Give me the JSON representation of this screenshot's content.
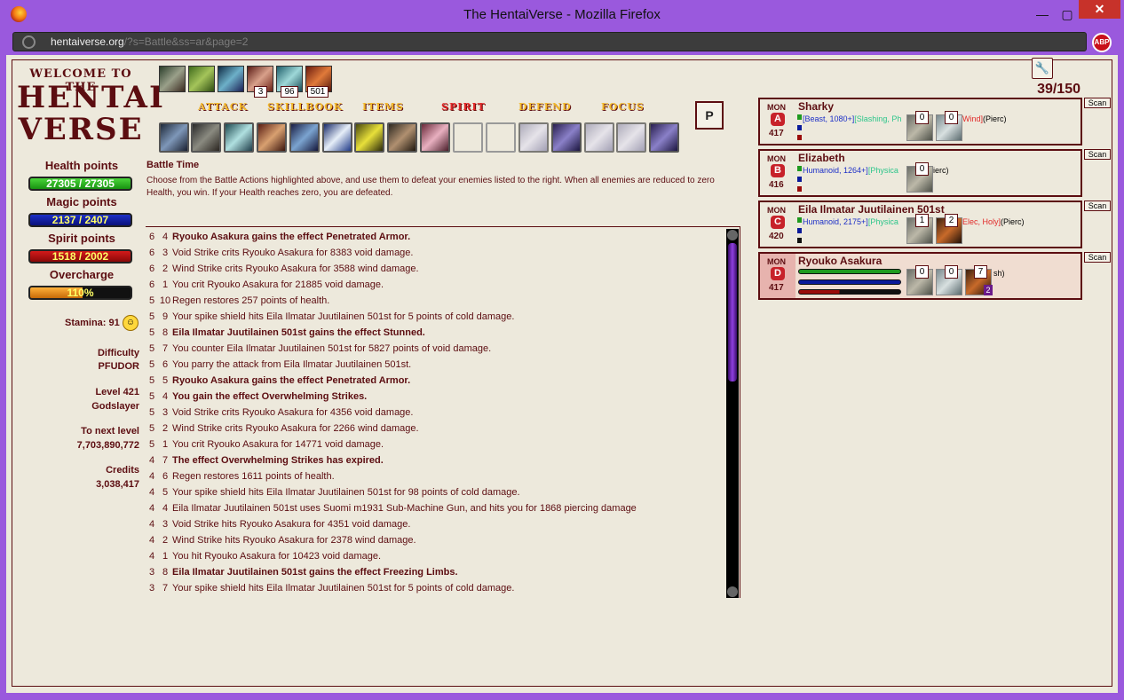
{
  "window": {
    "title": "The HentaiVerse - Mozilla Firefox",
    "minimize": "—",
    "maximize": "▢",
    "close": "✕"
  },
  "address": {
    "host": "hentaiverse.org",
    "path": "/?s=Battle&ss=ar&page=2"
  },
  "abp_label": "ABP",
  "sidebar": {
    "welcome": "WELCOME TO THE",
    "logo_line1": "HENTAI",
    "logo_line2": "VERSE",
    "health_label": "Health points",
    "health_value": "27305 / 27305",
    "magic_label": "Magic points",
    "magic_value": "2137 / 2407",
    "spirit_label": "Spirit points",
    "spirit_value": "1518 / 2002",
    "overcharge_label": "Overcharge",
    "overcharge_value": "110%",
    "overcharge_level": 0.52,
    "stamina": "Stamina: 91",
    "difficulty_label": "Difficulty",
    "difficulty_value": "PFUDOR",
    "level_label": "Level 421",
    "level_title": "Godslayer",
    "next_label": "To next level",
    "next_value": "7,703,890,772",
    "credits_label": "Credits",
    "credits_value": "3,038,417"
  },
  "status_counts": [
    "3",
    "96",
    "501"
  ],
  "menu": {
    "attack": "ATTACK",
    "skillbook": "SKILLBOOK",
    "items": "ITEMS",
    "spirit": "SPIRIT",
    "defend": "DEFEND",
    "focus": "FOCUS",
    "p": "P"
  },
  "battle": {
    "title": "Battle Time",
    "description": "Choose from the Battle Actions highlighted above, and use them to defeat your enemies listed to the right. When all enemies are reduced to zero Health, you win. If your Health reaches zero, you are defeated."
  },
  "log": [
    {
      "a": "6",
      "b": "4",
      "text": "Ryouko Asakura gains the effect Penetrated Armor.",
      "bold": true
    },
    {
      "a": "6",
      "b": "3",
      "text": "Void Strike crits Ryouko Asakura for 8383 void damage.",
      "bold": false
    },
    {
      "a": "6",
      "b": "2",
      "text": "Wind Strike crits Ryouko Asakura for 3588 wind damage.",
      "bold": false
    },
    {
      "a": "6",
      "b": "1",
      "text": "You crit Ryouko Asakura for 21885 void damage.",
      "bold": false
    },
    {
      "a": "5",
      "b": "10",
      "text": "Regen restores 257 points of health.",
      "bold": false
    },
    {
      "a": "5",
      "b": "9",
      "text": "Your spike shield hits Eila Ilmatar Juutilainen 501st for 5 points of cold damage.",
      "bold": false
    },
    {
      "a": "5",
      "b": "8",
      "text": "Eila Ilmatar Juutilainen 501st gains the effect Stunned.",
      "bold": true
    },
    {
      "a": "5",
      "b": "7",
      "text": "You counter Eila Ilmatar Juutilainen 501st for 5827 points of void damage.",
      "bold": false
    },
    {
      "a": "5",
      "b": "6",
      "text": "You parry the attack from Eila Ilmatar Juutilainen 501st.",
      "bold": false
    },
    {
      "a": "5",
      "b": "5",
      "text": "Ryouko Asakura gains the effect Penetrated Armor.",
      "bold": true
    },
    {
      "a": "5",
      "b": "4",
      "text": "You gain the effect Overwhelming Strikes.",
      "bold": true
    },
    {
      "a": "5",
      "b": "3",
      "text": "Void Strike crits Ryouko Asakura for 4356 void damage.",
      "bold": false
    },
    {
      "a": "5",
      "b": "2",
      "text": "Wind Strike crits Ryouko Asakura for 2266 wind damage.",
      "bold": false
    },
    {
      "a": "5",
      "b": "1",
      "text": "You crit Ryouko Asakura for 14771 void damage.",
      "bold": false
    },
    {
      "a": "4",
      "b": "7",
      "text": "The effect Overwhelming Strikes has expired.",
      "bold": true
    },
    {
      "a": "4",
      "b": "6",
      "text": "Regen restores 1611 points of health.",
      "bold": false
    },
    {
      "a": "4",
      "b": "5",
      "text": "Your spike shield hits Eila Ilmatar Juutilainen 501st for 98 points of cold damage.",
      "bold": false
    },
    {
      "a": "4",
      "b": "4",
      "text": "Eila Ilmatar Juutilainen 501st uses Suomi m1931 Sub-Machine Gun, and hits you for 1868 piercing damage",
      "bold": false
    },
    {
      "a": "4",
      "b": "3",
      "text": "Void Strike hits Ryouko Asakura for 4351 void damage.",
      "bold": false
    },
    {
      "a": "4",
      "b": "2",
      "text": "Wind Strike hits Ryouko Asakura for 2378 wind damage.",
      "bold": false
    },
    {
      "a": "4",
      "b": "1",
      "text": "You hit Ryouko Asakura for 10423 void damage.",
      "bold": false
    },
    {
      "a": "3",
      "b": "8",
      "text": "Eila Ilmatar Juutilainen 501st gains the effect Freezing Limbs.",
      "bold": true
    },
    {
      "a": "3",
      "b": "7",
      "text": "Your spike shield hits Eila Ilmatar Juutilainen 501st for 5 points of cold damage.",
      "bold": false
    }
  ],
  "round": "39/150",
  "monsters": [
    {
      "tag": "MON",
      "glyph": "A",
      "level": "417",
      "name": "Sharky",
      "info": [
        {
          "t": "[Beast, 1080+]",
          "c": "blue"
        },
        {
          "t": "[Slashing, Ph",
          "c": "green"
        }
      ],
      "info_tail": [
        {
          "t": "Wind]",
          "c": "red"
        },
        {
          "t": "(Pierc)",
          "c": "blk"
        }
      ],
      "effects": [
        "0",
        "0"
      ],
      "scan": "Scan"
    },
    {
      "tag": "MON",
      "glyph": "B",
      "level": "416",
      "name": "Elizabeth",
      "info": [
        {
          "t": "Humanoid, 1264+]",
          "c": "blue"
        },
        {
          "t": "[Physica",
          "c": "green"
        }
      ],
      "info_tail": [
        {
          "t": "ierc)",
          "c": "blk"
        }
      ],
      "effects": [
        "0"
      ],
      "scan": "Scan"
    },
    {
      "tag": "MON",
      "glyph": "C",
      "level": "420",
      "name": "Eila Ilmatar Juutilainen 501st",
      "info": [
        {
          "t": "Humanoid, 2175+]",
          "c": "blue"
        },
        {
          "t": "[Physica",
          "c": "green"
        }
      ],
      "info_tail": [
        {
          "t": "Elec, Holy]",
          "c": "red"
        },
        {
          "t": "(Pierc)",
          "c": "blk"
        }
      ],
      "effects": [
        "1",
        "2"
      ],
      "scan": "Scan"
    },
    {
      "tag": "MON",
      "glyph": "D",
      "level": "417",
      "name": "Ryouko Asakura",
      "info": [],
      "info_tail": [
        {
          "t": "sh)",
          "c": "blk"
        }
      ],
      "effects": [
        "0",
        "0",
        "7"
      ],
      "effect_extra": "2",
      "scan": "Scan"
    }
  ],
  "icons": {
    "firefox": "firefox-icon",
    "globe": "globe-icon",
    "wrench": "wrench-icon",
    "stamina": "laughing-face-icon"
  }
}
